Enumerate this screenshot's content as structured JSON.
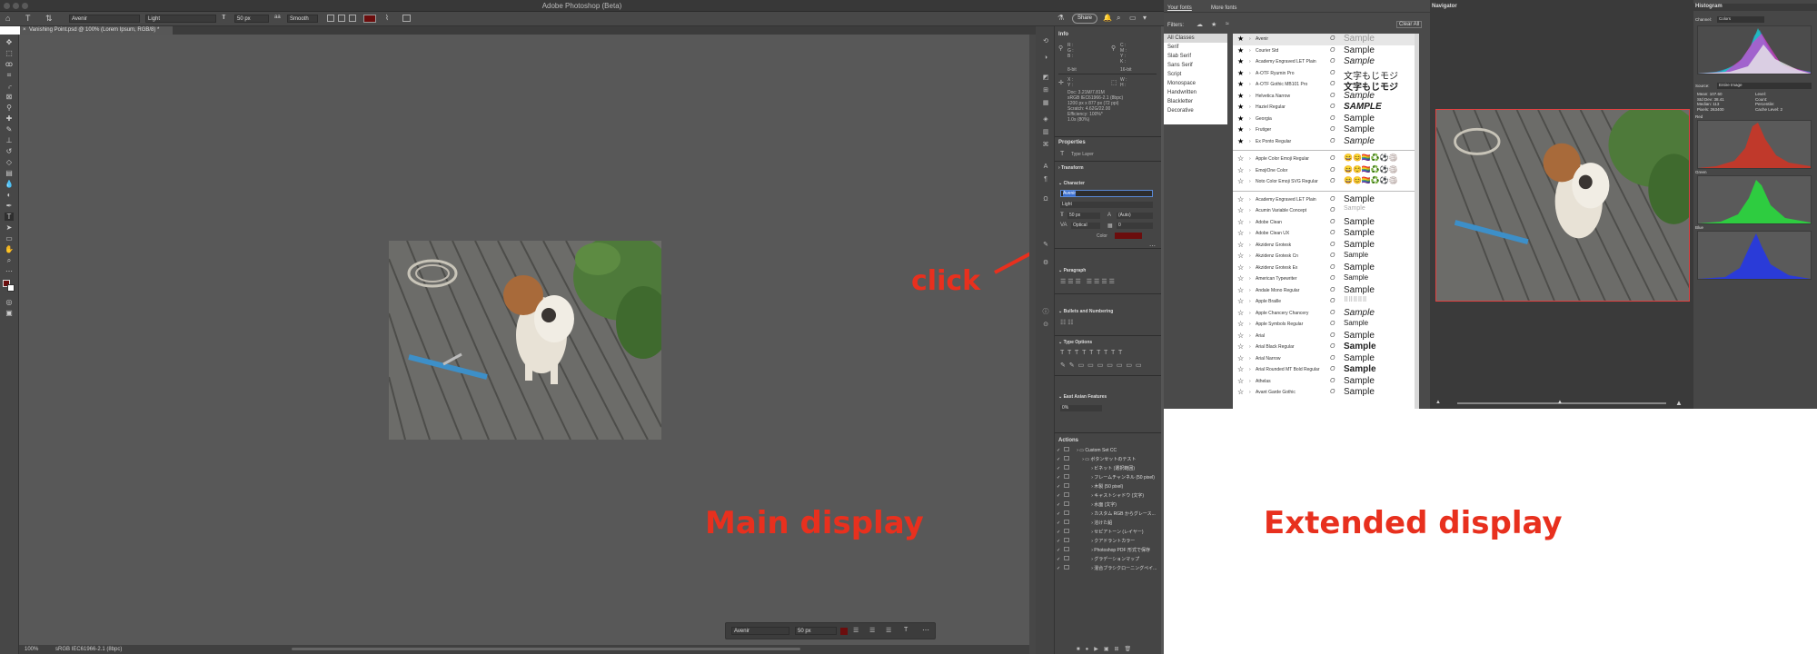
{
  "window": {
    "title": "Adobe Photoshop (Beta)"
  },
  "options_bar": {
    "font_family": "Avenir",
    "font_style": "Light",
    "font_size": "50 px",
    "antialias": "Smooth",
    "text_color": "#6b0d0d",
    "share_label": "Share"
  },
  "document_tab": {
    "label": "Vanishing Point.psd @ 100% (Lorem Ipsum, RGB/8) *"
  },
  "status_bar": {
    "zoom": "100%",
    "profile": "sRGB IEC61966-2.1 (8bpc)"
  },
  "annotations": {
    "click": "click",
    "main": "Main display",
    "extended": "Extended display"
  },
  "info_panel": {
    "title": "Info",
    "r": "R :",
    "g": "G :",
    "b": "B :",
    "bit1": "8-bit",
    "c": "C :",
    "m": "M :",
    "y": "Y :",
    "k": "K :",
    "bit2": "16-bit",
    "x": "X :",
    "yy": "Y :",
    "w": "W :",
    "h": "H :",
    "doc_lines": [
      "Doc: 3.21M/7.81M",
      "sRGB IEC61966-2.1 (8bpc)",
      "1200 px x 877 px (72 ppi)",
      "Scratch: 4.62G/22.00",
      "Efficiency: 100%*",
      "1.0s (80%)"
    ]
  },
  "properties": {
    "title": "Properties",
    "layer_type": "Type Layer",
    "transform": "Transform",
    "character": "Character",
    "font": "Avenir",
    "style": "Light",
    "size": "50 px",
    "leading": "(Auto)",
    "kern": "Optical",
    "tracking": "0",
    "color_label": "Color",
    "paragraph": "Paragraph",
    "bullets": "Bullets and Numbering",
    "type_options": "Type Options",
    "east_asian": "East Asian Features",
    "tsume": "0%"
  },
  "actions": {
    "title": "Actions",
    "items": [
      "Custom Set CC",
      "ボタンセットのテスト",
      "ビネット (選択範囲)",
      "フレームチャンネル (50 pixel)",
      "木製 (50 pixel)",
      "キャストシャドウ (文字)",
      "水面 (文字)",
      "カスタム RGB からグレース...",
      "溶けた鉛",
      "セピアトーン (レイヤー)",
      "クアドラントカラー",
      "Photoshop PDF 形式で保存",
      "グラデーションマップ",
      "混合ブラシクローニングペイ..."
    ]
  },
  "font_menu": {
    "tabs": [
      "Your fonts",
      "More fonts"
    ],
    "filters_label": "Filters:",
    "clear_all": "Clear All",
    "classes": [
      "All Classes",
      "Serif",
      "Slab Serif",
      "Sans Serif",
      "Script",
      "Monospace",
      "Handwritten",
      "Blackletter",
      "Decorative"
    ],
    "favorites": [
      {
        "name": "Avenir",
        "sample": "Sample"
      },
      {
        "name": "Courier Std",
        "sample": "Sample"
      },
      {
        "name": "Academy Engraved LET Plain",
        "sample": "Sample"
      },
      {
        "name": "A-OTF Ryumin Pro",
        "sample": "文字もじモジ"
      },
      {
        "name": "A-OTF Gothic MB101 Pro",
        "sample": "文字もじモジ"
      },
      {
        "name": "Helvetica Narrow",
        "sample": "Sample"
      },
      {
        "name": "Haziel Regular",
        "sample": "SAMPLE"
      },
      {
        "name": "Georgia",
        "sample": "Sample"
      },
      {
        "name": "Frutiger",
        "sample": "Sample"
      },
      {
        "name": "Ex Ponto Regular",
        "sample": "Sample"
      }
    ],
    "emoji": [
      {
        "name": "Apple Color Emoji Regular",
        "sample": "😄😊🏳️‍🌈♻️⚽🏐"
      },
      {
        "name": "EmojiOne Color",
        "sample": "😄☺️🏳️‍🌈♻️⚽🏐"
      },
      {
        "name": "Noto Color Emoji SVG Regular",
        "sample": "😄😊🏳️‍🌈♻️⚽🏐"
      }
    ],
    "all": [
      {
        "name": "Academy Engraved LET Plain",
        "sample": "Sample"
      },
      {
        "name": "Acumin Variable Concept",
        "sample": "Sample"
      },
      {
        "name": "Adobe Clean",
        "sample": "Sample"
      },
      {
        "name": "Adobe Clean UX",
        "sample": "Sample"
      },
      {
        "name": "Akzidenz Grotesk",
        "sample": "Sample"
      },
      {
        "name": "Akzidenz Grotesk Cn",
        "sample": "Sample"
      },
      {
        "name": "Akzidenz Grotesk Ex",
        "sample": "Sample"
      },
      {
        "name": "American Typewriter",
        "sample": "Sample"
      },
      {
        "name": "Andale Mono Regular",
        "sample": "Sample"
      },
      {
        "name": "Apple Braille",
        "sample": "⠿⠿⠿⠿⠿"
      },
      {
        "name": "Apple Chancery Chancery",
        "sample": "Sample"
      },
      {
        "name": "Apple Symbols Regular",
        "sample": "Sample"
      },
      {
        "name": "Arial",
        "sample": "Sample"
      },
      {
        "name": "Arial Black Regular",
        "sample": "Sample"
      },
      {
        "name": "Arial Narrow",
        "sample": "Sample"
      },
      {
        "name": "Arial Rounded MT Bold Regular",
        "sample": "Sample"
      },
      {
        "name": "Athelas",
        "sample": "Sample"
      },
      {
        "name": "Avant Garde Gothic",
        "sample": "Sample"
      }
    ]
  },
  "navigator": {
    "title": "Navigator"
  },
  "histogram": {
    "title": "Histogram",
    "channel_label": "Channel:",
    "channel_value": "Colors",
    "source_label": "Source:",
    "source_value": "Entire Image",
    "stats_left": [
      "Mean: 107.60",
      "Std Dev: 38.41",
      "Median: 113",
      "Pixels: 263400"
    ],
    "stats_right": [
      "Level:",
      "Count:",
      "Percentile:",
      "Cache Level: 2"
    ],
    "labels": [
      "Red",
      "Green",
      "Blue"
    ],
    "colors": {
      "red": "#c0392b",
      "green": "#2ecc40",
      "blue": "#2a3bd8"
    }
  }
}
